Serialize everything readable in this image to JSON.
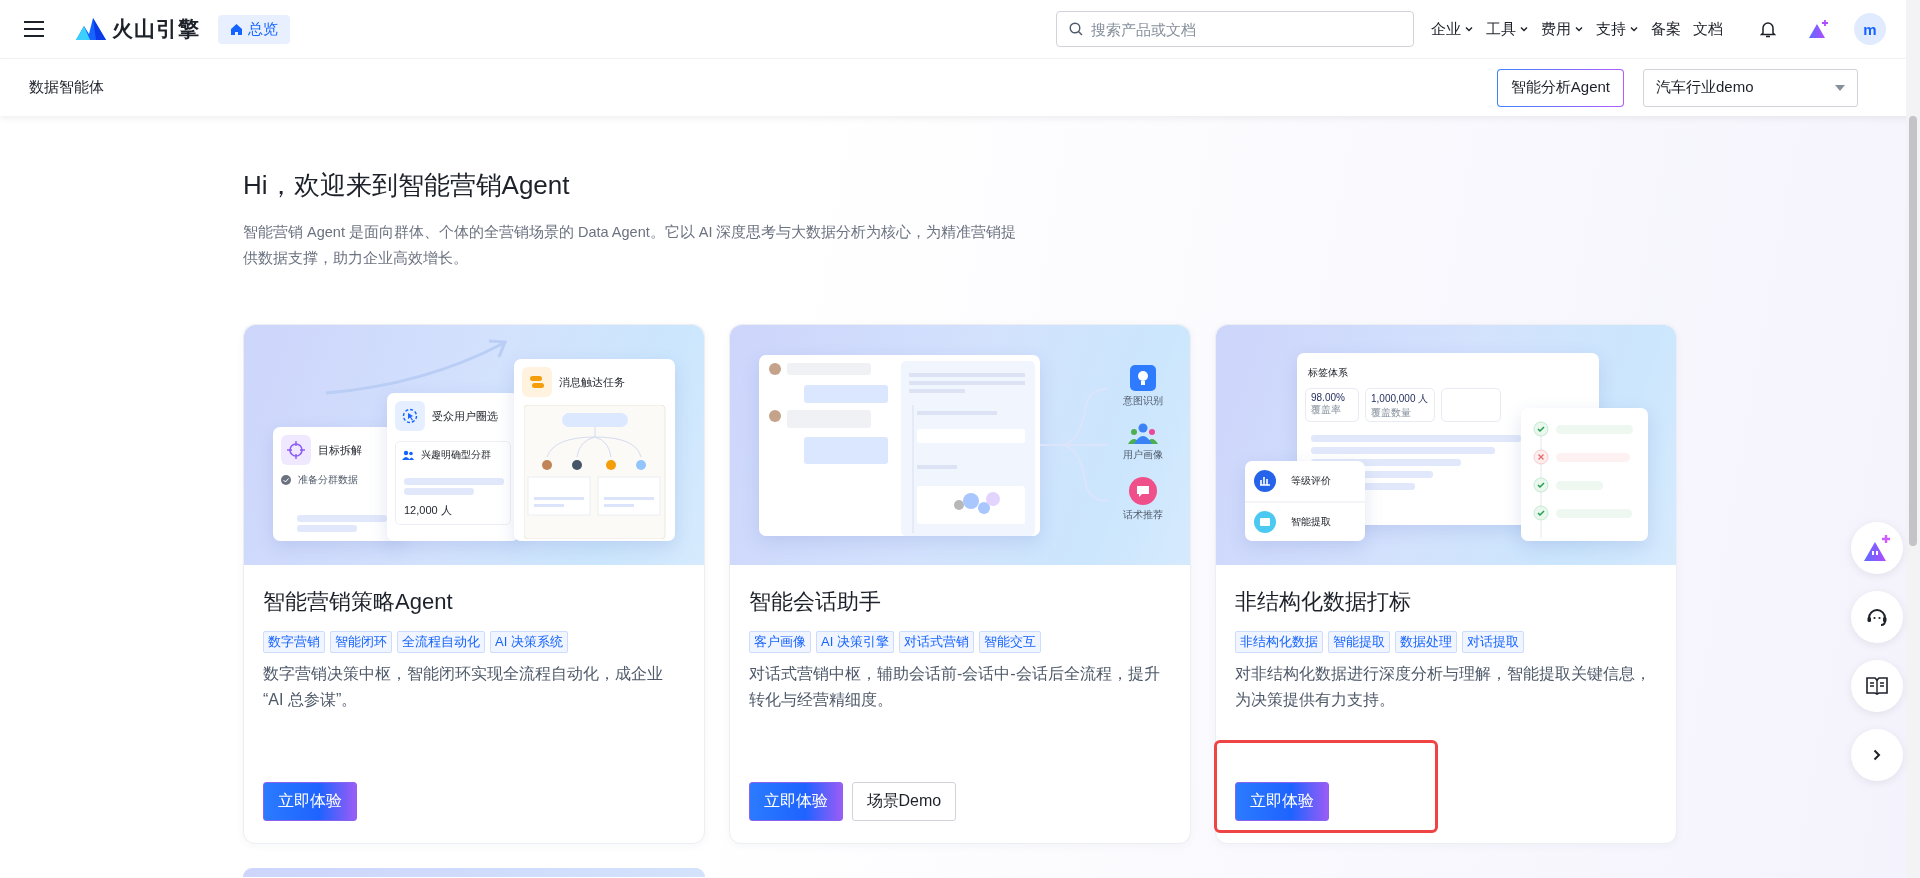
{
  "header": {
    "logo_text": "火山引擎",
    "home_tab": "总览",
    "search": {
      "placeholder": "搜索产品或文档"
    },
    "nav": [
      {
        "label": "企业",
        "dropdown": true
      },
      {
        "label": "工具",
        "dropdown": true
      },
      {
        "label": "费用",
        "dropdown": true
      },
      {
        "label": "支持",
        "dropdown": true
      },
      {
        "label": "备案",
        "dropdown": false
      },
      {
        "label": "文档",
        "dropdown": false
      }
    ],
    "avatar": "m"
  },
  "subheader": {
    "title": "数据智能体",
    "agent_button": "智能分析Agent",
    "select": {
      "value": "汽车行业demo"
    }
  },
  "intro": {
    "heading": "Hi，欢迎来到智能营销Agent",
    "description": "智能营销 Agent 是面向群体、个体的全营销场景的 Data Agent。它以 AI 深度思考与大数据分析为核心，为精准营销提供数据支撑，助力企业高效增长。"
  },
  "cards": [
    {
      "illustration": {
        "kind": "strategy",
        "labels": [
          "目标拆解",
          "准备分群数据",
          "受众用户圈选",
          "兴趣明确型分群",
          "12,000 人",
          "消息触达任务"
        ]
      },
      "title": "智能营销策略Agent",
      "tags": [
        "数字营销",
        "智能闭环",
        "全流程自动化",
        "AI 决策系统"
      ],
      "description": "数字营销决策中枢，智能闭环实现全流程自动化，成企业 “AI 总参谋”。",
      "buttons": [
        {
          "label": "立即体验",
          "kind": "primary"
        }
      ],
      "highlighted": false
    },
    {
      "illustration": {
        "kind": "chat",
        "labels": [
          "意图识别",
          "用户画像",
          "话术推荐"
        ]
      },
      "title": "智能会话助手",
      "tags": [
        "客户画像",
        "AI 决策引擎",
        "对话式营销",
        "智能交互"
      ],
      "description": "对话式营销中枢，辅助会话前-会话中-会话后全流程，提升转化与经营精细度。",
      "buttons": [
        {
          "label": "立即体验",
          "kind": "primary"
        },
        {
          "label": "场景Demo",
          "kind": "secondary"
        }
      ],
      "highlighted": false
    },
    {
      "illustration": {
        "kind": "tagging",
        "labels": [
          "标签体系",
          "98.00%",
          "覆盖率",
          "1,000,000 人",
          "覆盖数量",
          "等级评价",
          "智能提取"
        ]
      },
      "title": "非结构化数据打标",
      "tags": [
        "非结构化数据",
        "智能提取",
        "数据处理",
        "对话提取"
      ],
      "description": "对非结构化数据进行深度分析与理解，智能提取关键信息，为决策提供有力支持。",
      "buttons": [
        {
          "label": "立即体验",
          "kind": "primary"
        }
      ],
      "highlighted": true
    }
  ],
  "side_buttons": [
    {
      "kind": "assistant"
    },
    {
      "kind": "support"
    },
    {
      "kind": "docs"
    },
    {
      "kind": "expand"
    }
  ]
}
